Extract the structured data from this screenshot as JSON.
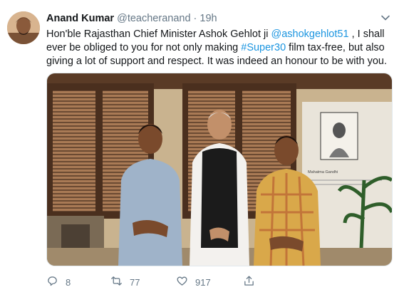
{
  "tweet": {
    "author_name": "Anand Kumar",
    "author_handle": "@teacheranand",
    "separator": "·",
    "time": "19h",
    "text_part1": "Hon'ble Rajasthan Chief Minister Ashok Gehlot ji ",
    "mention": "@ashokgehlot51",
    "text_part2": " , I shall ever be obliged to you for not only making ",
    "hashtag": "#Super30",
    "text_part3": " film tax-free, but also giving a lot of support and respect. It was indeed an honour to be with you.",
    "photo_sign_text": "Mahatma Gandhi"
  },
  "actions": {
    "reply_count": "8",
    "retweet_count": "77",
    "like_count": "917"
  },
  "icons": {
    "reply": "reply-icon",
    "retweet": "retweet-icon",
    "like": "heart-icon",
    "share": "share-icon",
    "more": "chevron-down-icon"
  },
  "colors": {
    "link": "#1b95e0",
    "secondary_text": "#657786"
  }
}
